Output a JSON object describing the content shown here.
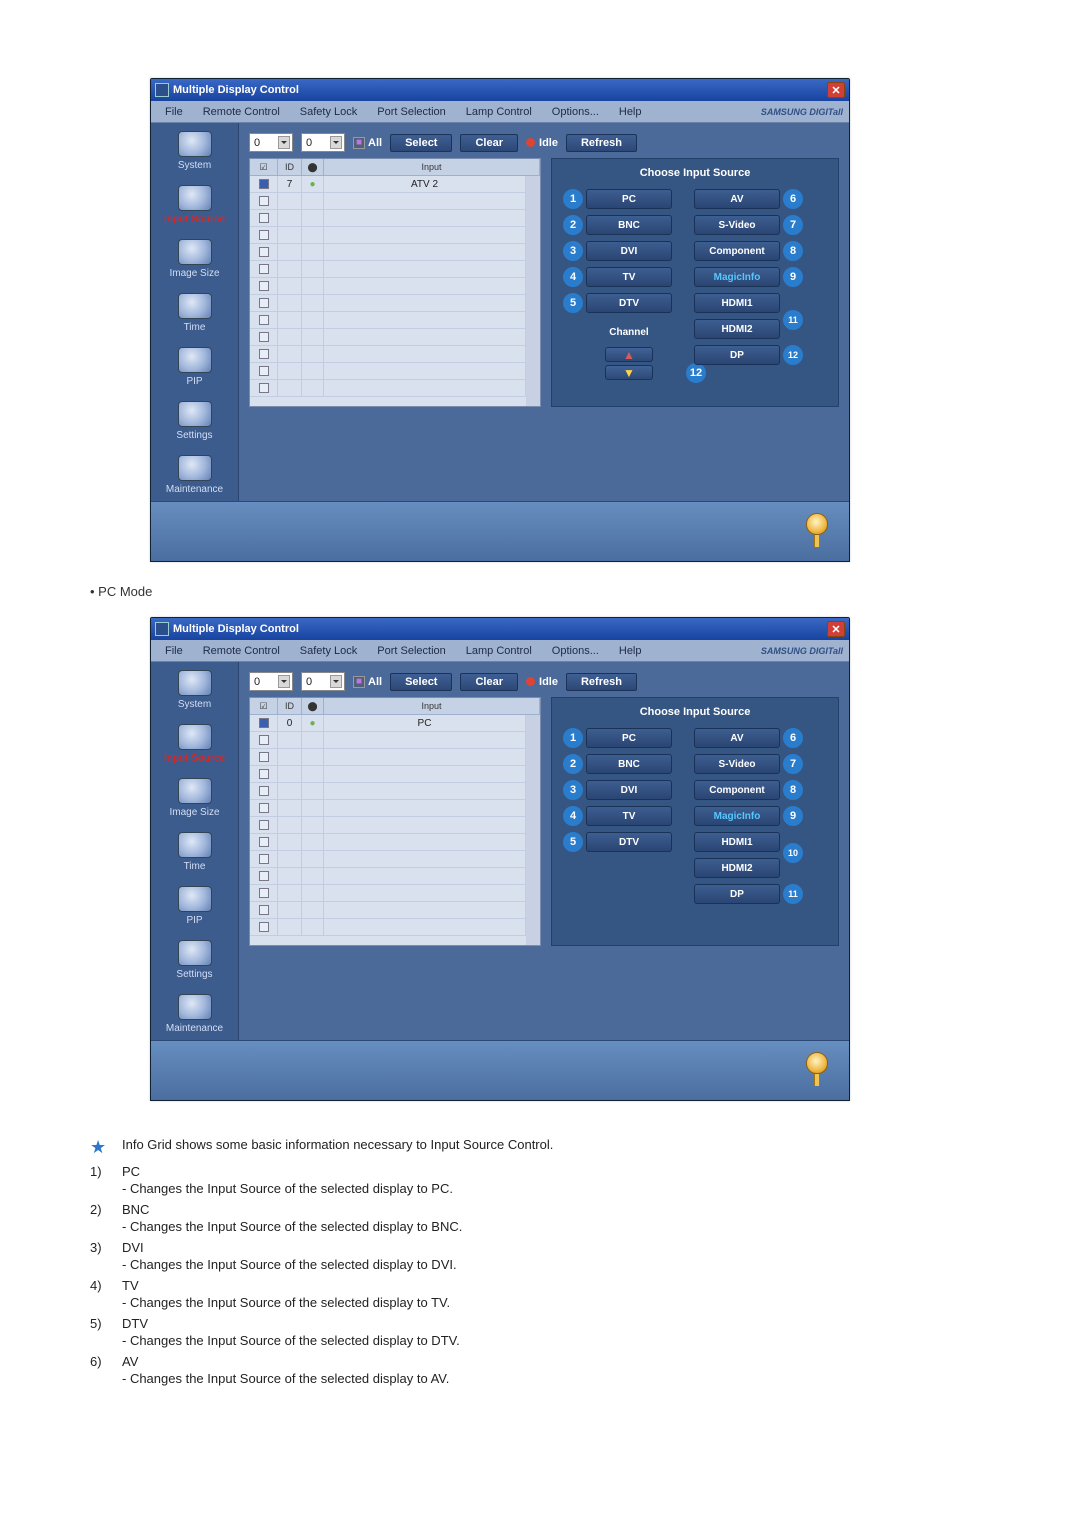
{
  "window": {
    "title": "Multiple Display Control",
    "close_glyph": "✕",
    "brand": "SAMSUNG DIGITall",
    "menu": [
      "File",
      "Remote Control",
      "Safety Lock",
      "Port Selection",
      "Lamp Control",
      "Options...",
      "Help"
    ],
    "sidebar": [
      {
        "label": "System"
      },
      {
        "label": "Input Source",
        "active": true
      },
      {
        "label": "Image Size"
      },
      {
        "label": "Time"
      },
      {
        "label": "PIP"
      },
      {
        "label": "Settings"
      },
      {
        "label": "Maintenance"
      }
    ],
    "toolbar": {
      "sel1": "0",
      "sel2": "0",
      "all": "All",
      "select": "Select",
      "clear": "Clear",
      "idle": "Idle",
      "refresh": "Refresh"
    },
    "grid": {
      "headers": {
        "c1": "☑",
        "c2": "ID",
        "c3": "⬤",
        "c4": "Input"
      }
    },
    "panel": {
      "title": "Choose Input Source",
      "left": [
        {
          "n": "1",
          "label": "PC"
        },
        {
          "n": "2",
          "label": "BNC"
        },
        {
          "n": "3",
          "label": "DVI"
        },
        {
          "n": "4",
          "label": "TV"
        },
        {
          "n": "5",
          "label": "DTV"
        }
      ],
      "right_a": [
        {
          "n": "6",
          "label": "AV"
        },
        {
          "n": "7",
          "label": "S-Video"
        },
        {
          "n": "8",
          "label": "Component"
        },
        {
          "n": "9",
          "label": "MagicInfo",
          "magic": true
        },
        {
          "n": "10",
          "label": "HDMI1"
        },
        {
          "n": "11",
          "label": "HDMI2",
          "extra_dp": true
        },
        {
          "n": "12",
          "label": "DP",
          "is_dp_on_b": true
        }
      ],
      "right_b": [
        {
          "n": "6",
          "label": "AV"
        },
        {
          "n": "7",
          "label": "S-Video"
        },
        {
          "n": "8",
          "label": "Component"
        },
        {
          "n": "9",
          "label": "MagicInfo",
          "magic": true
        },
        {
          "n": "10",
          "label": "HDMI1"
        },
        {
          "n": "",
          "label": "HDMI2"
        },
        {
          "n": "11",
          "label": "DP"
        }
      ],
      "channel": {
        "label": "Channel",
        "callout": "12"
      }
    }
  },
  "shot_a": {
    "row1_id": "7",
    "row1_input": "ATV 2",
    "show_channel": true
  },
  "shot_b": {
    "row1_id": "0",
    "row1_input": "PC",
    "show_channel": false
  },
  "between_label": "PC Mode",
  "info_star": "Info Grid shows some basic information necessary to Input Source Control.",
  "items": [
    {
      "n": "1)",
      "t": "PC",
      "s": "- Changes the Input Source of the selected display to PC."
    },
    {
      "n": "2)",
      "t": "BNC",
      "s": "- Changes the Input Source of the selected display to BNC."
    },
    {
      "n": "3)",
      "t": "DVI",
      "s": "- Changes the Input Source of the selected display to DVI."
    },
    {
      "n": "4)",
      "t": "TV",
      "s": "- Changes the Input Source of the selected display to TV."
    },
    {
      "n": "5)",
      "t": "DTV",
      "s": "- Changes the Input Source of the selected display to DTV."
    },
    {
      "n": "6)",
      "t": "AV",
      "s": "- Changes the Input Source of the selected display to AV."
    }
  ]
}
